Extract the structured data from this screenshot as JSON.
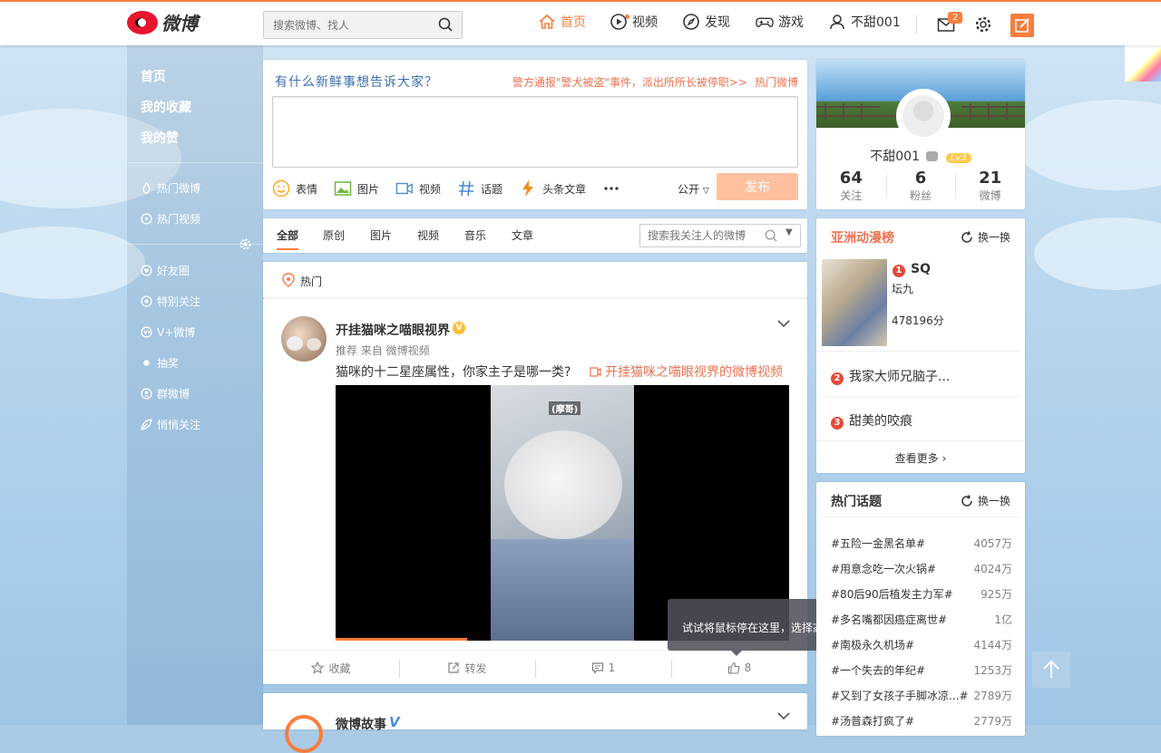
{
  "header": {
    "logo_text": "微博",
    "search_placeholder": "搜索微博、找人",
    "nav": [
      {
        "label": "首页",
        "icon": "home-icon"
      },
      {
        "label": "视频",
        "icon": "video-icon"
      },
      {
        "label": "发现",
        "icon": "compass-icon"
      },
      {
        "label": "游戏",
        "icon": "gamepad-icon"
      },
      {
        "label": "不甜001",
        "icon": "user-icon"
      }
    ],
    "message_badge": "2",
    "accent_color": "#fa7d3c"
  },
  "sidebar": {
    "main": [
      "首页",
      "我的收藏",
      "我的赞"
    ],
    "groups1": [
      {
        "label": "热门微博",
        "icon": "fire-icon"
      },
      {
        "label": "热门视频",
        "icon": "play-circle-icon"
      }
    ],
    "groups2": [
      {
        "label": "好友圈",
        "icon": "heart-circle-icon"
      },
      {
        "label": "特别关注",
        "icon": "eye-circle-icon"
      },
      {
        "label": "V+微博",
        "icon": "vplus-icon"
      },
      {
        "label": "抽奖",
        "icon": "dot-icon"
      },
      {
        "label": "群微博",
        "icon": "group-icon"
      },
      {
        "label": "悄悄关注",
        "icon": "leaf-icon"
      }
    ]
  },
  "publisher": {
    "prompt": "有什么新鲜事想告诉大家？",
    "news": "警方通报\"警犬被盗\"事件，派出所所长被停职>>",
    "hot_link": "热门微博",
    "tools": [
      "表情",
      "图片",
      "视频",
      "话题",
      "头条文章"
    ],
    "visibility": "公开",
    "submit": "发布"
  },
  "feed_tabs": {
    "tabs": [
      "全部",
      "原创",
      "图片",
      "视频",
      "音乐",
      "文章"
    ],
    "active": "全部",
    "search_placeholder": "搜索我关注人的微博"
  },
  "hot_label": "热门",
  "post": {
    "username": "开挂猫咪之喵眼视界",
    "verified": "V",
    "meta": "推荐 来自 微博视频",
    "text": "猫咪的十二星座属性，你家主子是哪一类?",
    "link": "开挂猫咪之喵眼视界的微博视频",
    "video_caption": "(摩哥)",
    "actions": {
      "favorite": "收藏",
      "repost": "转发",
      "comments": "1",
      "likes": "8"
    }
  },
  "post2": {
    "username": "微博故事",
    "verified": "V"
  },
  "tooltip": {
    "text": "试试将鼠标停在这里，选择态度",
    "close": "✕"
  },
  "profile": {
    "name": "不甜001",
    "level": "Lv3",
    "stats": [
      {
        "value": "64",
        "label": "关注"
      },
      {
        "value": "6",
        "label": "粉丝"
      },
      {
        "value": "21",
        "label": "微博"
      }
    ]
  },
  "ranking": {
    "title": "亚洲动漫榜",
    "refresh": "换一换",
    "items": [
      {
        "rank": "1",
        "title": "SQ",
        "author": "坛九",
        "score": "478196分"
      },
      {
        "rank": "2",
        "title": "我家大师兄脑子..."
      },
      {
        "rank": "3",
        "title": "甜美的咬痕"
      }
    ],
    "more": "查看更多"
  },
  "topics": {
    "title": "热门话题",
    "refresh": "换一换",
    "items": [
      {
        "name": "#五险一金黑名单#",
        "count": "4057万"
      },
      {
        "name": "#用意念吃一次火锅#",
        "count": "4024万"
      },
      {
        "name": "#80后90后植发主力军#",
        "count": "925万"
      },
      {
        "name": "#多名嘴都因癌症离世#",
        "count": "1亿"
      },
      {
        "name": "#南极永久机场#",
        "count": "4144万"
      },
      {
        "name": "#一个失去的年纪#",
        "count": "1253万"
      },
      {
        "name": "#又到了女孩子手脚冰凉...#",
        "count": "2789万"
      },
      {
        "name": "#汤普森打疯了#",
        "count": "2779万"
      }
    ]
  }
}
